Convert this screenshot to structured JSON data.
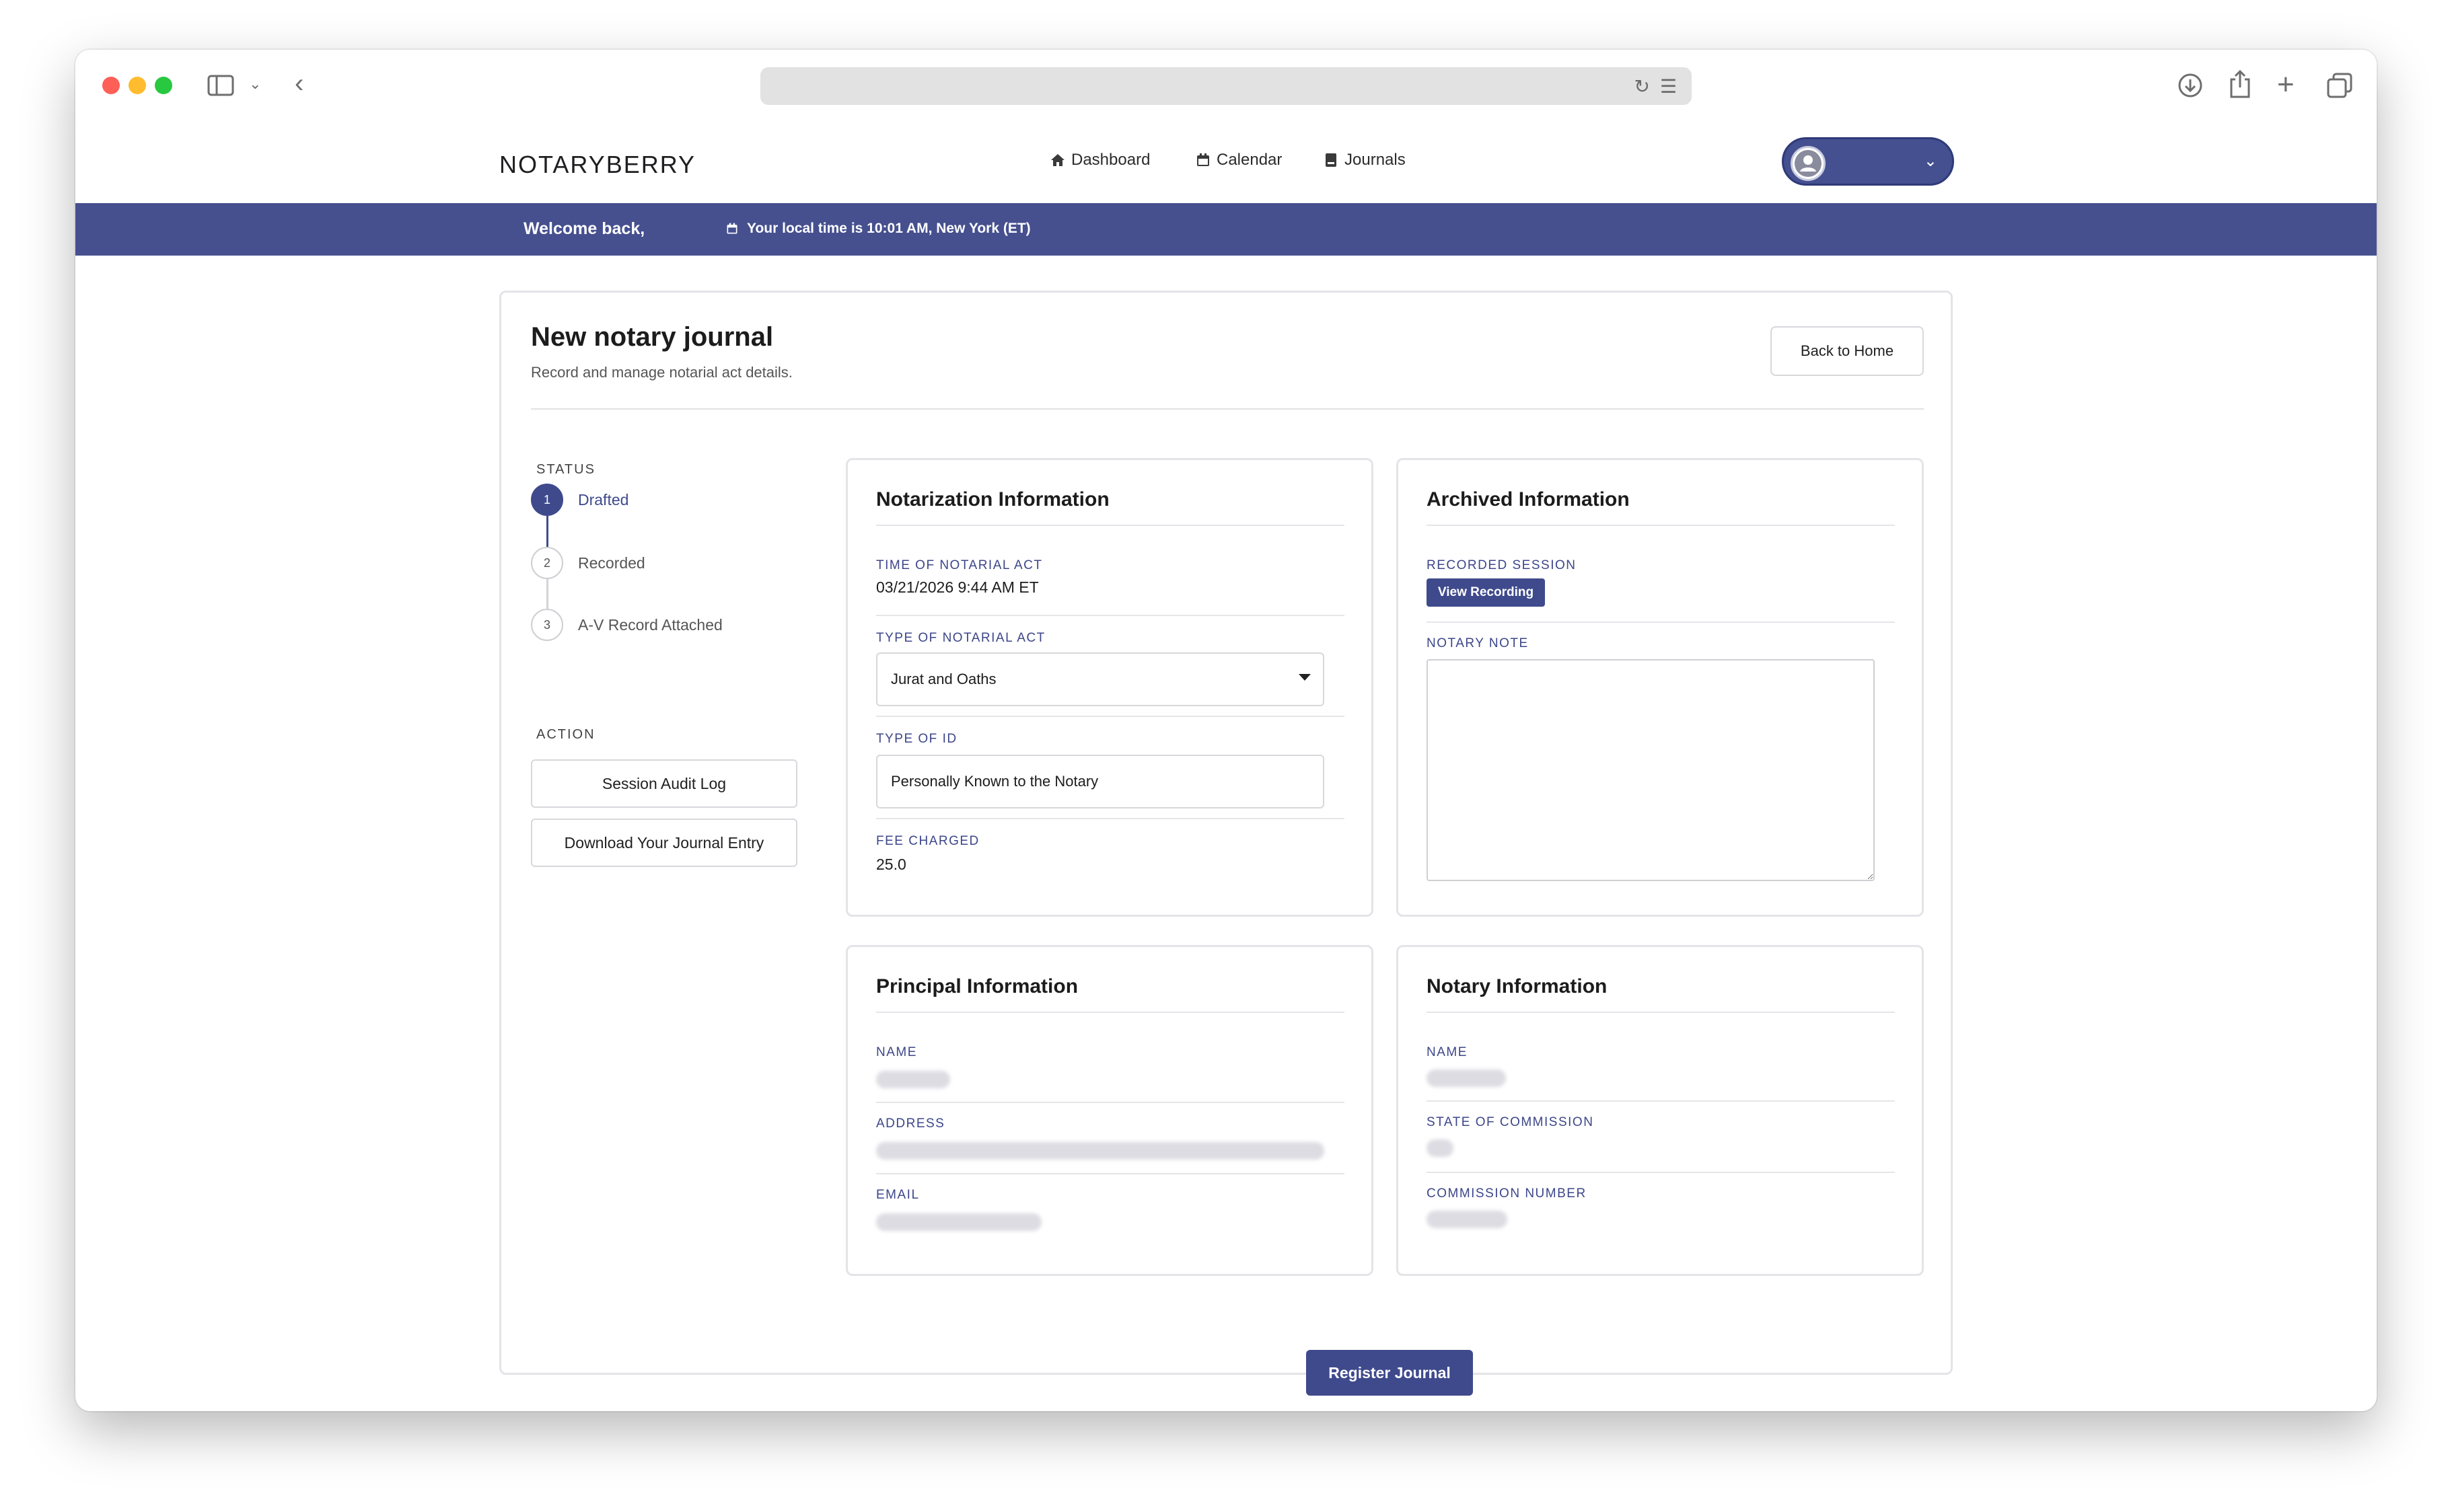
{
  "app": {
    "logo": "NOTARYBERRY",
    "nav": [
      {
        "label": "Dashboard",
        "icon": "home-icon"
      },
      {
        "label": "Calendar",
        "icon": "calendar-icon"
      },
      {
        "label": "Journals",
        "icon": "book-icon"
      }
    ]
  },
  "banner": {
    "welcome": "Welcome back,",
    "local_time": "Your local time is 10:01 AM, New York (ET)"
  },
  "page": {
    "title": "New notary journal",
    "subtitle": "Record and manage notarial act details.",
    "back_button": "Back to Home"
  },
  "status": {
    "label": "STATUS",
    "steps": [
      {
        "number": "1",
        "label": "Drafted",
        "active": true
      },
      {
        "number": "2",
        "label": "Recorded",
        "active": false
      },
      {
        "number": "3",
        "label": "A-V Record Attached",
        "active": false
      }
    ]
  },
  "action": {
    "label": "ACTION",
    "buttons": [
      "Session Audit Log",
      "Download Your Journal Entry"
    ]
  },
  "notarization": {
    "title": "Notarization Information",
    "time_label": "TIME OF NOTARIAL ACT",
    "time_value": "03/21/2026 9:44 AM ET",
    "type_label": "TYPE OF NOTARIAL ACT",
    "type_value": "Jurat and Oaths",
    "id_label": "TYPE OF ID",
    "id_value": "Personally Known to the Notary",
    "fee_label": "FEE CHARGED",
    "fee_value": "25.0"
  },
  "archived": {
    "title": "Archived Information",
    "session_label": "RECORDED SESSION",
    "view_recording": "View Recording",
    "note_label": "NOTARY NOTE"
  },
  "principal": {
    "title": "Principal Information",
    "name_label": "NAME",
    "address_label": "ADDRESS",
    "email_label": "EMAIL"
  },
  "notary": {
    "title": "Notary Information",
    "name_label": "NAME",
    "state_label": "STATE OF COMMISSION",
    "commission_label": "COMMISSION NUMBER"
  },
  "register_button": "Register Journal",
  "colors": {
    "brand": "#46508f",
    "accent": "#3f4a8c"
  }
}
